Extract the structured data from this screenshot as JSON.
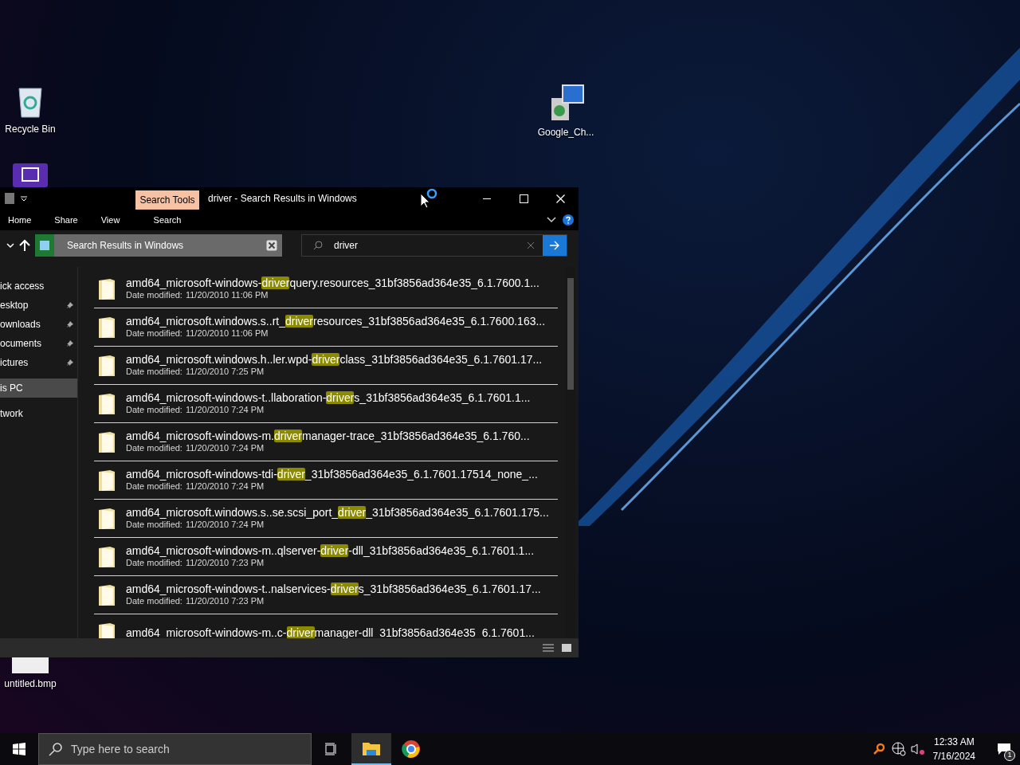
{
  "desktop_icons": [
    {
      "kind": "recycle",
      "label": "Recycle Bin"
    },
    {
      "kind": "installer",
      "label": "Google_Ch..."
    },
    {
      "kind": "app"
    },
    {
      "kind": "image",
      "label": "untitled.bmp"
    }
  ],
  "explorer": {
    "title": "driver - Search Results in Windows",
    "contextual_group": {
      "label": "Search Tools",
      "tabs": [
        {
          "label": "Search"
        }
      ]
    },
    "ribbon_tabs": [
      {
        "label": "Home"
      },
      {
        "label": "Share"
      },
      {
        "label": "View"
      }
    ],
    "address": "Search Results in Windows",
    "search": {
      "value": "driver"
    },
    "nav": [
      {
        "label": "ick access",
        "selected": false,
        "pinned": false
      },
      {
        "label": "esktop",
        "selected": false,
        "pinned": true
      },
      {
        "label": "ownloads",
        "selected": false,
        "pinned": true
      },
      {
        "label": "ocuments",
        "selected": false,
        "pinned": true
      },
      {
        "label": "ictures",
        "selected": false,
        "pinned": true
      },
      {
        "label": "is PC",
        "selected": true,
        "pinned": false
      },
      {
        "label": "twork",
        "selected": false,
        "pinned": false
      }
    ],
    "results": [
      {
        "before": "amd64_microsoft-windows-",
        "match": "driver",
        "after": "query.resources_31bf3856ad364e35_6.1.7600.1...",
        "date_label": "Date modified:",
        "date": "11/20/2010 11:06 PM"
      },
      {
        "before": "amd64_microsoft.windows.s..rt_",
        "match": "driver",
        "after": "resources_31bf3856ad364e35_6.1.7600.163...",
        "date_label": "Date modified:",
        "date": "11/20/2010 11:06 PM"
      },
      {
        "before": "amd64_microsoft.windows.h..ler.wpd-",
        "match": "driver",
        "after": "class_31bf3856ad364e35_6.1.7601.17...",
        "date_label": "Date modified:",
        "date": "11/20/2010 7:25 PM"
      },
      {
        "before": "amd64_microsoft-windows-t..llaboration-",
        "match": "driver",
        "after": "s_31bf3856ad364e35_6.1.7601.1...",
        "date_label": "Date modified:",
        "date": "11/20/2010 7:24 PM"
      },
      {
        "before": "amd64_microsoft-windows-m.",
        "match": "driver",
        "after": "manager-trace_31bf3856ad364e35_6.1.760...",
        "date_label": "Date modified:",
        "date": "11/20/2010 7:24 PM"
      },
      {
        "before": "amd64_microsoft-windows-tdi-",
        "match": "driver",
        "after": "_31bf3856ad364e35_6.1.7601.17514_none_...",
        "date_label": "Date modified:",
        "date": "11/20/2010 7:24 PM"
      },
      {
        "before": "amd64_microsoft.windows.s..se.scsi_port_",
        "match": "driver",
        "after": "_31bf3856ad364e35_6.1.7601.175...",
        "date_label": "Date modified:",
        "date": "11/20/2010 7:24 PM"
      },
      {
        "before": "amd64_microsoft-windows-m..qlserver-",
        "match": "driver",
        "after": "-dll_31bf3856ad364e35_6.1.7601.1...",
        "date_label": "Date modified:",
        "date": "11/20/2010 7:23 PM"
      },
      {
        "before": "amd64_microsoft-windows-t..nalservices-",
        "match": "driver",
        "after": "s_31bf3856ad364e35_6.1.7601.17...",
        "date_label": "Date modified:",
        "date": "11/20/2010 7:23 PM"
      },
      {
        "before": "amd64_microsoft-windows-m..c-",
        "match": "driver",
        "after": "manager-dll_31bf3856ad364e35_6.1.7601..."
      }
    ]
  },
  "taskbar": {
    "search_placeholder": "Type here to search",
    "apps": [
      {
        "kind": "taskview",
        "selected": false
      },
      {
        "kind": "explorer",
        "selected": true
      },
      {
        "kind": "chrome",
        "selected": false
      }
    ],
    "time": "12:33 AM",
    "date": "7/16/2024",
    "notification_count": "1"
  }
}
